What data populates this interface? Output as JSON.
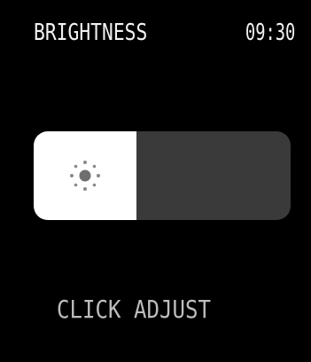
{
  "header": {
    "title": "BRIGHTNESS",
    "time": "09:30"
  },
  "brightness_slider": {
    "level": 0.4,
    "icon": "sun-icon",
    "fill_color": "#ffffff",
    "track_color": "#3a3a3a"
  },
  "footer": {
    "hint": "CLICK ADJUST"
  }
}
